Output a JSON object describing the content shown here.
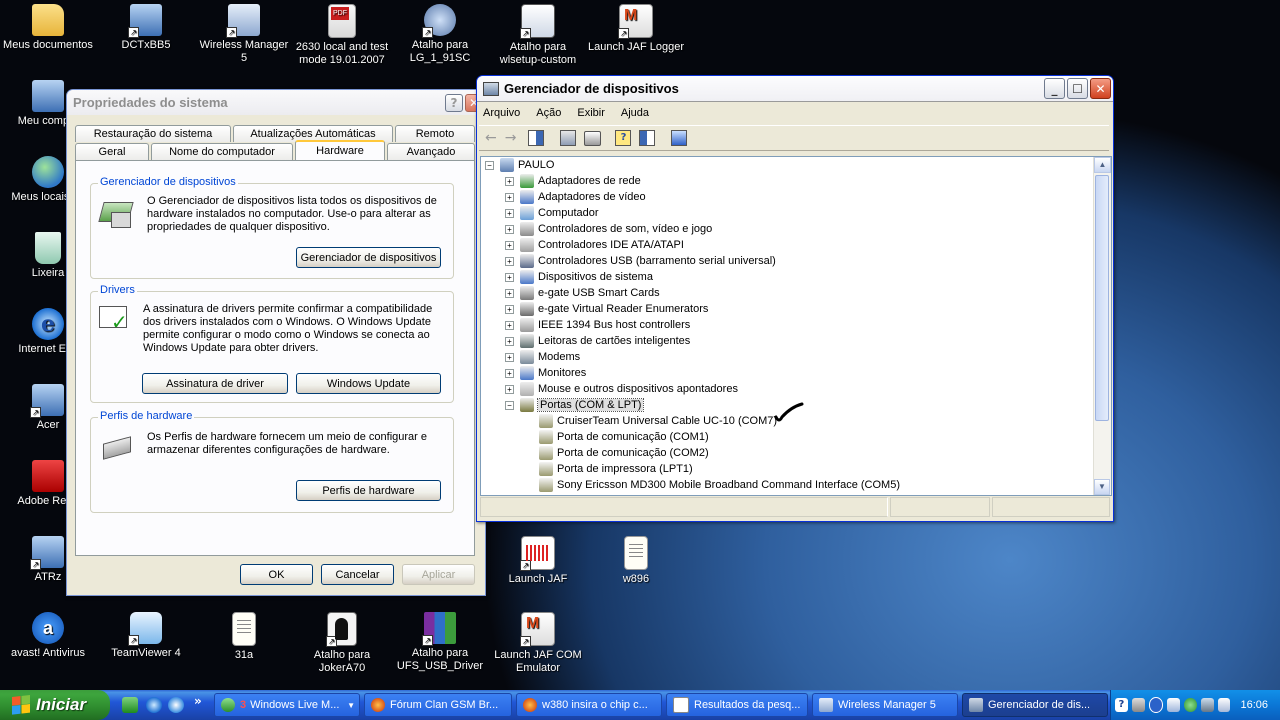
{
  "desktop": {
    "icons": [
      {
        "label": "Meus documentos"
      },
      {
        "label": "DCTxBB5"
      },
      {
        "label": "Wireless Manager 5"
      },
      {
        "label": "2630 local and test mode 19.01.2007"
      },
      {
        "label": "Atalho para LG_1_91SC"
      },
      {
        "label": "Atalho para wlsetup-custom"
      },
      {
        "label": "Launch JAF Logger"
      },
      {
        "label": "Meu comput"
      },
      {
        "label": "Meus locais de"
      },
      {
        "label": "Lixeira"
      },
      {
        "label": "Internet Exp"
      },
      {
        "label": "Acer"
      },
      {
        "label": "Adobe Read"
      },
      {
        "label": "ATRz"
      },
      {
        "label": "avast! Antivirus"
      },
      {
        "label": "TeamViewer 4"
      },
      {
        "label": "31a"
      },
      {
        "label": "Atalho para JokerA70"
      },
      {
        "label": "Atalho para UFS_USB_Driver"
      },
      {
        "label": "Launch JAF COM Emulator"
      },
      {
        "label": "Launch JAF"
      },
      {
        "label": "w896"
      }
    ]
  },
  "sysprops": {
    "title": "Propriedades do sistema",
    "help_glyph": "?",
    "tabs_row1": [
      "Restauração do sistema",
      "Atualizações Automáticas",
      "Remoto"
    ],
    "tabs_row2": [
      "Geral",
      "Nome do computador",
      "Hardware",
      "Avançado"
    ],
    "devmgr_group": {
      "title": "Gerenciador de dispositivos",
      "text": "O Gerenciador de dispositivos lista todos os dispositivos de hardware instalados no computador. Use-o para alterar as propriedades de qualquer dispositivo.",
      "button": "Gerenciador de dispositivos"
    },
    "drivers_group": {
      "title": "Drivers",
      "text": "A assinatura de drivers permite confirmar a compatibilidade dos drivers instalados com o Windows. O Windows Update permite configurar o modo como o Windows se conecta ao Windows Update para obter drivers.",
      "button_sign": "Assinatura de driver",
      "button_update": "Windows Update"
    },
    "profiles_group": {
      "title": "Perfis de hardware",
      "text": "Os Perfis de hardware fornecem um meio de configurar e armazenar diferentes configurações de hardware.",
      "button": "Perfis de hardware"
    },
    "ok": "OK",
    "cancel": "Cancelar",
    "apply": "Aplicar"
  },
  "devmgr": {
    "title": "Gerenciador de dispositivos",
    "menu": [
      "Arquivo",
      "Ação",
      "Exibir",
      "Ajuda"
    ],
    "root": "PAULO",
    "categories": [
      "Adaptadores de rede",
      "Adaptadores de vídeo",
      "Computador",
      "Controladores de som, vídeo e jogo",
      "Controladores IDE ATA/ATAPI",
      "Controladores USB (barramento serial universal)",
      "Dispositivos de sistema",
      "e-gate USB Smart Cards",
      "e-gate Virtual Reader Enumerators",
      "IEEE 1394 Bus host controllers",
      "Leitoras de cartões inteligentes",
      "Modems",
      "Monitores",
      "Mouse e outros dispositivos apontadores",
      "Portas (COM & LPT)"
    ],
    "ports": [
      "CruiserTeam Universal Cable UC-10 (COM7)",
      "Porta de comunicação (COM1)",
      "Porta de comunicação (COM2)",
      "Porta de impressora (LPT1)",
      "Sony Ericsson MD300 Mobile Broadband Command Interface (COM5)"
    ],
    "collapse_glyph": "−",
    "expand_glyph": "+"
  },
  "taskbar": {
    "start": "Iniciar",
    "more_glyph": "»",
    "tasks": [
      {
        "label": "Windows Live M...",
        "badge": "3"
      },
      {
        "label": "Fórum Clan GSM Br..."
      },
      {
        "label": "w380 insira o chip c..."
      },
      {
        "label": "Resultados da pesq..."
      },
      {
        "label": "Wireless Manager 5"
      },
      {
        "label": "Gerenciador de dis..."
      }
    ],
    "clock": "16:06"
  }
}
